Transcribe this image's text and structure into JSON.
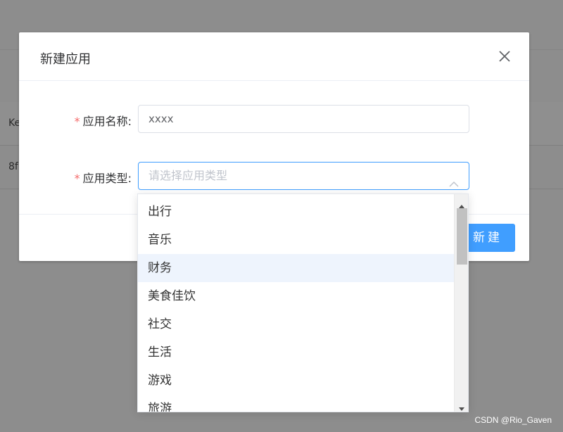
{
  "background": {
    "header_cell": "Ke",
    "row_cell": "8f"
  },
  "dialog": {
    "title": "新建应用",
    "close_icon": "close-icon",
    "fields": {
      "name_label": "应用名称:",
      "name_value": "xxxx",
      "type_label": "应用类型:",
      "type_placeholder": "请选择应用类型",
      "required_mark": "*"
    },
    "primary_button": "新建"
  },
  "dropdown": {
    "options": [
      "出行",
      "音乐",
      "财务",
      "美食佳饮",
      "社交",
      "生活",
      "游戏",
      "旅游"
    ],
    "hovered_index": 2
  },
  "watermark": "CSDN @Rio_Gaven",
  "colors": {
    "accent": "#409eff",
    "required": "#f56c6c",
    "hover_bg": "#eef4fd"
  }
}
